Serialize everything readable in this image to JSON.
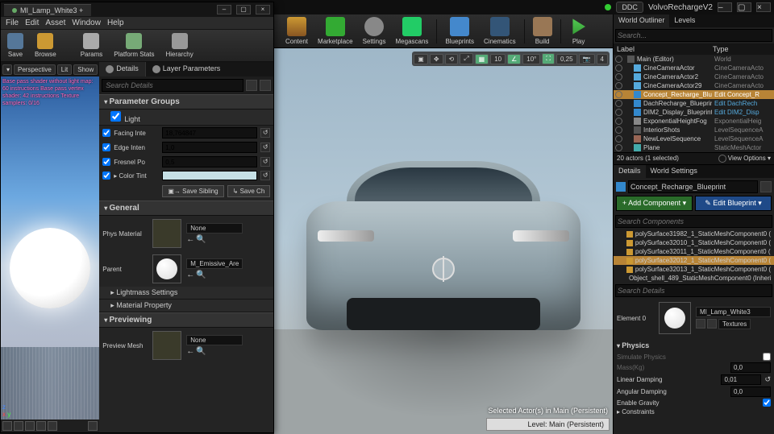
{
  "project": {
    "ddc": "DDC",
    "name": "VolvoRechargeV2"
  },
  "innerWindow": {
    "title": "MI_Lamp_White3 +",
    "menu": [
      "File",
      "Edit",
      "Asset",
      "Window",
      "Help"
    ],
    "toolbar": {
      "save": "Save",
      "browse": "Browse",
      "params": "Params",
      "platformStats": "Platform Stats",
      "hierarchy": "Hierarchy"
    },
    "vpChips": {
      "perspective": "Perspective",
      "lit": "Lit",
      "show": "Show"
    },
    "vpInfo": "Base pass shader without light map: 60 instructions\nBase pass vertex shader: 42 instructions\nTexture samplers: 0/16",
    "tabs": {
      "details": "Details",
      "layerParams": "Layer Parameters"
    },
    "searchPlaceholder": "Search Details",
    "sections": {
      "paramGroups": "Parameter Groups",
      "light": "Light",
      "general": "General",
      "lightmass": "Lightmass Settings",
      "materialProp": "Material Property",
      "previewing": "Previewing"
    },
    "light": {
      "facing": {
        "label": "Facing Inte",
        "value": "18,764847"
      },
      "edge": {
        "label": "Edge Inten",
        "value": "1,0"
      },
      "fresnel": {
        "label": "Fresnel Po",
        "value": "0,5"
      },
      "colorTint": {
        "label": "Color Tint"
      }
    },
    "buttons": {
      "saveSibling": "Save Sibling",
      "saveChild": "Save Ch"
    },
    "general": {
      "physMat": {
        "label": "Phys Material",
        "value": "None"
      },
      "parent": {
        "label": "Parent",
        "value": "M_Emissive_Are"
      }
    },
    "preview": {
      "label": "Preview Mesh",
      "value": "None"
    }
  },
  "mainToolbar": {
    "content": "Content",
    "marketplace": "Marketplace",
    "settings": "Settings",
    "megascans": "Megascans",
    "blueprints": "Blueprints",
    "cinematics": "Cinematics",
    "build": "Build",
    "play": "Play"
  },
  "viewportWidgets": {
    "grid": "10",
    "angle": "10°",
    "scale": "0,25",
    "cam": "4"
  },
  "viewportStatus": {
    "selected": "Selected Actor(s) in Main (Persistent)",
    "level": "Level: Main (Persistent)"
  },
  "outliner": {
    "tabs": {
      "worldOutliner": "World Outliner",
      "levels": "Levels"
    },
    "searchPlaceholder": "Search...",
    "cols": {
      "label": "Label",
      "type": "Type"
    },
    "rows": [
      {
        "indent": 0,
        "icon": "folder",
        "name": "Main (Editor)",
        "type": "World"
      },
      {
        "indent": 1,
        "icon": "cam",
        "name": "CineCameraActor",
        "type": "CineCameraActo"
      },
      {
        "indent": 1,
        "icon": "cam",
        "name": "CineCameraActor2",
        "type": "CineCameraActo"
      },
      {
        "indent": 1,
        "icon": "cam",
        "name": "CineCameraActor29",
        "type": "CineCameraActo"
      },
      {
        "indent": 1,
        "icon": "bp",
        "name": "Concept_Recharge_Blueprint",
        "type": "Edit Concept_R",
        "sel": true,
        "link": true
      },
      {
        "indent": 1,
        "icon": "bp",
        "name": "DachRecharge_Blueprint",
        "type": "Edit DachRech",
        "link": true
      },
      {
        "indent": 1,
        "icon": "bp",
        "name": "DIM2_Display_Blueprint",
        "type": "Edit DIM2_Disp",
        "link": true
      },
      {
        "indent": 1,
        "icon": "fog",
        "name": "ExponentialHeightFog",
        "type": "ExponentialHeig"
      },
      {
        "indent": 1,
        "icon": "folder",
        "name": "InteriorShots",
        "type": "LevelSequenceA"
      },
      {
        "indent": 1,
        "icon": "seq",
        "name": "NewLevelSequence",
        "type": "LevelSequenceA"
      },
      {
        "indent": 1,
        "icon": "mesh",
        "name": "Plane",
        "type": "StaticMeshActor"
      }
    ],
    "footer": {
      "count": "20 actors (1 selected)",
      "viewOpts": "View Options"
    }
  },
  "detailsRight": {
    "tabs": {
      "details": "Details",
      "worldSettings": "World Settings"
    },
    "actorName": "Concept_Recharge_Blueprint",
    "addComponent": "+ Add Component",
    "editBlueprint": "Edit Blueprint",
    "searchComponents": "Search Components",
    "components": [
      "polySurface31982_1_StaticMeshComponent0 (",
      "polySurface32010_1_StaticMeshComponent0 (",
      "polySurface32011_1_StaticMeshComponent0 (",
      "polySurface32012_1_StaticMeshComponent0 (",
      "polySurface32013_1_StaticMeshComponent0 (",
      "Object_shell_489_StaticMeshComponent0 (Inheri"
    ],
    "selectedComponent": 3,
    "searchDetails": "Search Details",
    "material": {
      "element": "Element 0",
      "name": "MI_Lamp_White3",
      "textures": "Textures"
    },
    "physics": {
      "header": "Physics",
      "simulate": "Simulate Physics",
      "massKg": {
        "label": "Mass(Kg)",
        "value": "0,0"
      },
      "linearDamping": {
        "label": "Linear Damping",
        "value": "0,01"
      },
      "angularDamping": {
        "label": "Angular Damping",
        "value": "0,0"
      },
      "enableGravity": "Enable Gravity",
      "constraints": "Constraints"
    }
  }
}
